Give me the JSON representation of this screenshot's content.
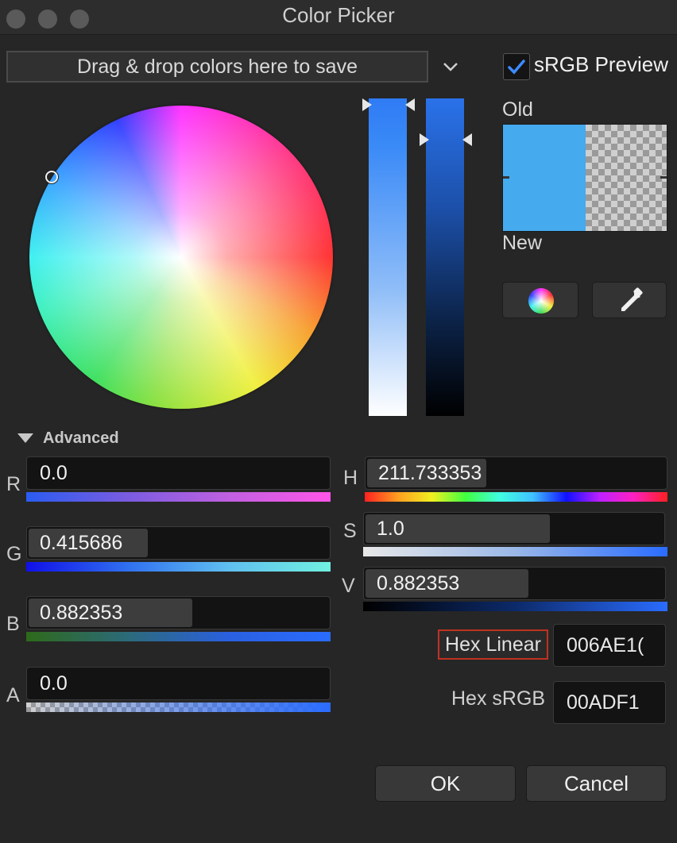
{
  "window": {
    "title": "Color Picker"
  },
  "toolbar": {
    "drop_zone_text": "Drag & drop colors here to save",
    "srgb_preview_label": "sRGB Preview",
    "srgb_preview_checked": true
  },
  "preview": {
    "old_label": "Old",
    "new_label": "New",
    "color": "#45aaee"
  },
  "advanced": {
    "label": "Advanced",
    "rgba": [
      {
        "axis": "R",
        "value": "0.0",
        "level": 0.0
      },
      {
        "axis": "G",
        "value": "0.415686",
        "level": 0.415686
      },
      {
        "axis": "B",
        "value": "0.882353",
        "level": 0.882353
      },
      {
        "axis": "A",
        "value": "0.0",
        "level": 0.0
      }
    ],
    "hsv": [
      {
        "axis": "H",
        "value": "211.733353",
        "level": 0.588
      },
      {
        "axis": "S",
        "value": "1.0",
        "level": 1.0
      },
      {
        "axis": "V",
        "value": "0.882353",
        "level": 0.882353
      }
    ]
  },
  "hex": {
    "linear_label": "Hex Linear",
    "linear_value": "006AE1(",
    "srgb_label": "Hex sRGB",
    "srgb_value": "00ADF1"
  },
  "buttons": {
    "ok": "OK",
    "cancel": "Cancel"
  },
  "icons": [
    "close-icon",
    "minimize-icon",
    "zoom-icon",
    "chevron-down-icon",
    "checkmark-icon",
    "color-wheel-icon",
    "eyedropper-icon"
  ]
}
